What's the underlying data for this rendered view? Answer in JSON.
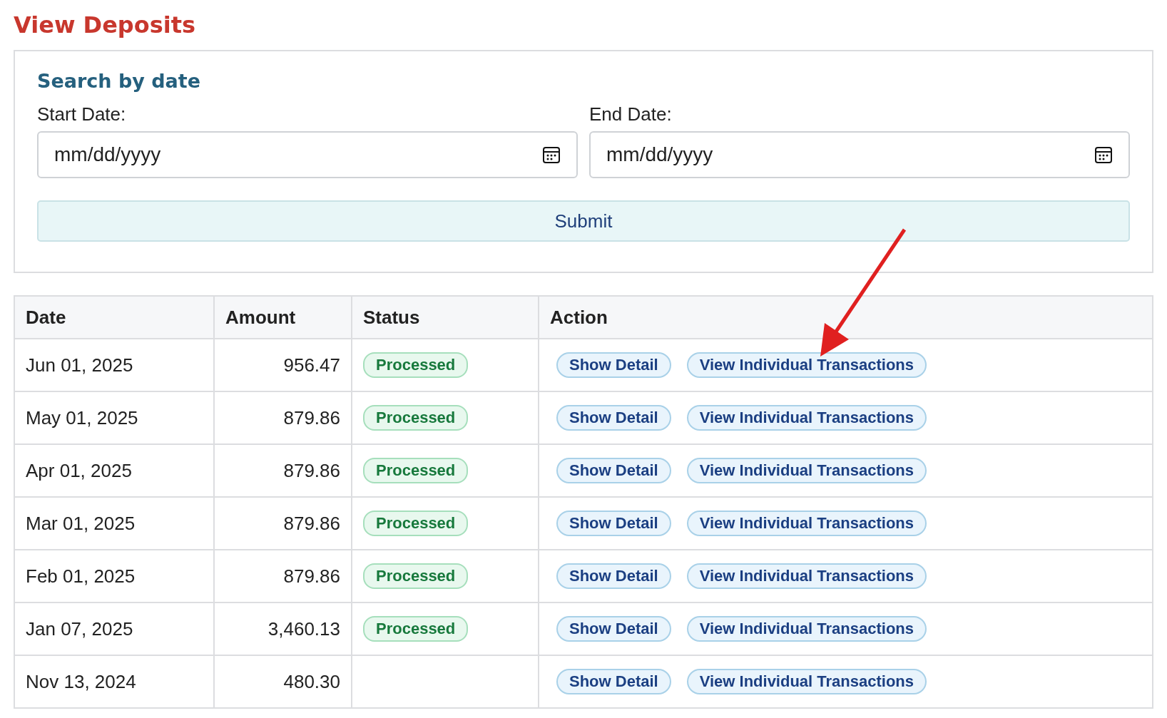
{
  "page_title": "View Deposits",
  "search": {
    "heading": "Search by date",
    "start": {
      "label": "Start Date:",
      "placeholder": "mm/dd/yyyy"
    },
    "end": {
      "label": "End Date:",
      "placeholder": "mm/dd/yyyy"
    },
    "submit": "Submit"
  },
  "table": {
    "columns": [
      "Date",
      "Amount",
      "Status",
      "Action"
    ],
    "rows": [
      {
        "date": "Jun 01, 2025",
        "amount": "956.47",
        "status": "Processed",
        "actions": [
          "Show Detail",
          "View Individual Transactions"
        ]
      },
      {
        "date": "May 01, 2025",
        "amount": "879.86",
        "status": "Processed",
        "actions": [
          "Show Detail",
          "View Individual Transactions"
        ]
      },
      {
        "date": "Apr 01, 2025",
        "amount": "879.86",
        "status": "Processed",
        "actions": [
          "Show Detail",
          "View Individual Transactions"
        ]
      },
      {
        "date": "Mar 01, 2025",
        "amount": "879.86",
        "status": "Processed",
        "actions": [
          "Show Detail",
          "View Individual Transactions"
        ]
      },
      {
        "date": "Feb 01, 2025",
        "amount": "879.86",
        "status": "Processed",
        "actions": [
          "Show Detail",
          "View Individual Transactions"
        ]
      },
      {
        "date": "Jan 07, 2025",
        "amount": "3,460.13",
        "status": "Processed",
        "actions": [
          "Show Detail",
          "View Individual Transactions"
        ]
      },
      {
        "date": "Nov 13, 2024",
        "amount": "480.30",
        "actions": [
          "Show Detail",
          "View Individual Transactions"
        ]
      }
    ]
  }
}
